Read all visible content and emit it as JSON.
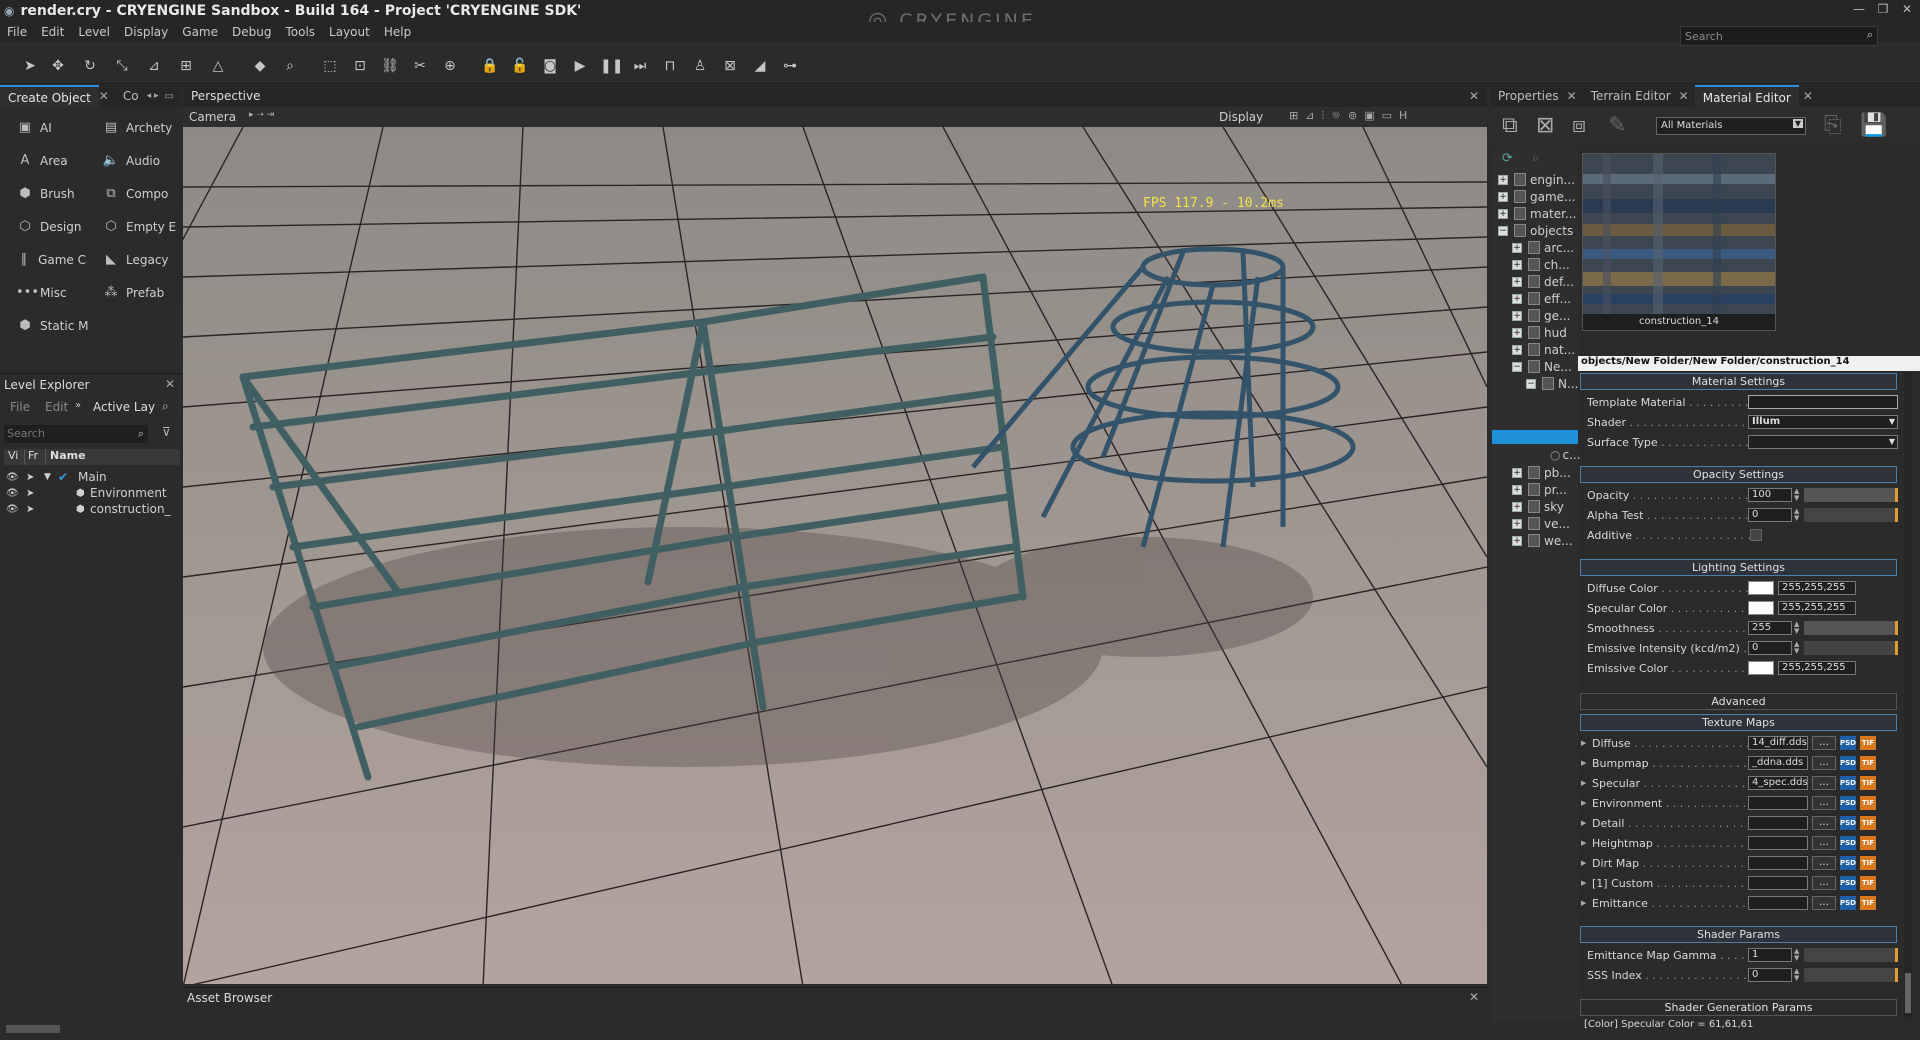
{
  "window": {
    "title": "render.cry - CRYENGINE Sandbox - Build 164 - Project 'CRYENGINE SDK'",
    "logo": "CRYENGINE",
    "search_placeholder": "Search"
  },
  "menu": [
    "File",
    "Edit",
    "Level",
    "Display",
    "Game",
    "Debug",
    "Tools",
    "Layout",
    "Help"
  ],
  "left": {
    "tabs": [
      "Create Object",
      "Co"
    ],
    "create_items": [
      {
        "icon": "ai-icon",
        "label": "AI"
      },
      {
        "icon": "archetype-icon",
        "label": "Archety"
      },
      {
        "icon": "area-icon",
        "label": "Area"
      },
      {
        "icon": "audio-icon",
        "label": "Audio"
      },
      {
        "icon": "brush-icon",
        "label": "Brush"
      },
      {
        "icon": "component-icon",
        "label": "Compo"
      },
      {
        "icon": "designer-icon",
        "label": "Design"
      },
      {
        "icon": "empty-entity-icon",
        "label": "Empty E"
      },
      {
        "icon": "game-camera-icon",
        "label": "Game C"
      },
      {
        "icon": "legacy-icon",
        "label": "Legacy"
      },
      {
        "icon": "misc-icon",
        "label": "Misc"
      },
      {
        "icon": "prefab-icon",
        "label": "Prefab"
      },
      {
        "icon": "static-mesh-icon",
        "label": "Static M"
      }
    ],
    "level_explorer": {
      "title": "Level Explorer",
      "menu": [
        "File",
        "Edit"
      ],
      "active_layer": "Active Laye",
      "search_placeholder": "Search",
      "columns": [
        "Vi",
        "Fr",
        "Name"
      ],
      "rows": [
        "Main",
        "Environment",
        "construction_"
      ]
    }
  },
  "viewport": {
    "tab": "Perspective",
    "camera_label": "Camera",
    "display_label": "Display",
    "fps_text": "FPS 117.9 - 10.2ms",
    "asset_browser": "Asset Browser"
  },
  "right": {
    "tabs": [
      "Properties",
      "Terrain Editor",
      "Material Editor"
    ],
    "filter": "All Materials",
    "tree": [
      "engin...",
      "game...",
      "mater...",
      "objects",
      "arc...",
      "ch...",
      "def...",
      "eff...",
      "ge...",
      "hud",
      "nat...",
      "Ne...",
      "N...",
      "",
      "",
      "",
      "",
      "c...",
      "pb...",
      "pr...",
      "sky",
      "ve...",
      "we..."
    ],
    "preview_name": "construction_14",
    "material_path": "objects/New Folder/New Folder/construction_14",
    "sections": {
      "material_settings": "Material Settings",
      "opacity_settings": "Opacity Settings",
      "lighting_settings": "Lighting Settings",
      "advanced": "Advanced",
      "texture_maps": "Texture Maps",
      "shader_params": "Shader Params",
      "shader_gen": "Shader Generation Params"
    },
    "material": {
      "template_label": "Template Material",
      "shader_label": "Shader",
      "shader_value": "Illum",
      "surface_label": "Surface Type"
    },
    "opacity": {
      "opacity_label": "Opacity",
      "opacity_value": "100",
      "alpha_label": "Alpha Test",
      "alpha_value": "0",
      "additive_label": "Additive"
    },
    "lighting": {
      "diffuse_label": "Diffuse Color",
      "diffuse_value": "255,255,255",
      "specular_label": "Specular Color",
      "specular_value": "255,255,255",
      "smoothness_label": "Smoothness",
      "smoothness_value": "255",
      "emissive_int_label": "Emissive Intensity (kcd/m2)",
      "emissive_int_value": "0",
      "emissive_label": "Emissive Color",
      "emissive_value": "255,255,255"
    },
    "textures": [
      {
        "label": "Diffuse",
        "value": "14_diff.dds"
      },
      {
        "label": "Bumpmap",
        "value": "_ddna.dds"
      },
      {
        "label": "Specular",
        "value": "4_spec.dds"
      },
      {
        "label": "Environment",
        "value": ""
      },
      {
        "label": "Detail",
        "value": ""
      },
      {
        "label": "Heightmap",
        "value": ""
      },
      {
        "label": "Dirt Map",
        "value": ""
      },
      {
        "label": "[1] Custom",
        "value": ""
      },
      {
        "label": "Emittance",
        "value": ""
      }
    ],
    "shader_params": [
      {
        "label": "Emittance Map Gamma",
        "value": "1"
      },
      {
        "label": "SSS Index",
        "value": "0"
      }
    ],
    "status": "[Color] Specular Color = 61,61,61"
  }
}
